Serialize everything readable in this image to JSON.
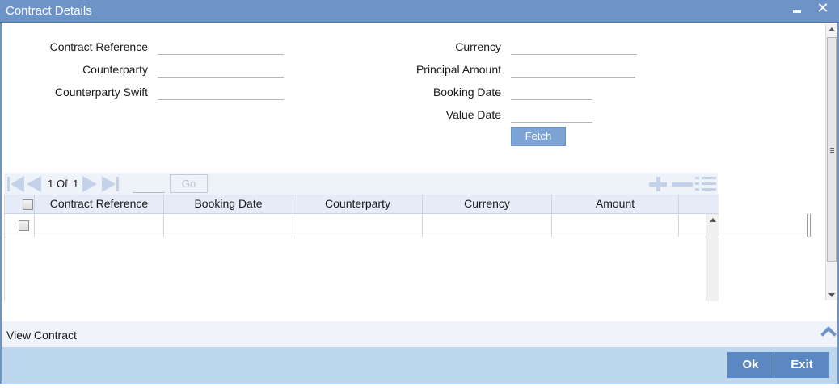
{
  "window": {
    "title": "Contract Details"
  },
  "form": {
    "left": [
      {
        "label": "Contract Reference",
        "value": ""
      },
      {
        "label": "Counterparty",
        "value": ""
      },
      {
        "label": "Counterparty Swift",
        "value": ""
      }
    ],
    "right": [
      {
        "label": "Currency",
        "value": ""
      },
      {
        "label": "Principal Amount",
        "value": ""
      },
      {
        "label": "Booking Date",
        "value": ""
      },
      {
        "label": "Value Date",
        "value": ""
      }
    ],
    "fetch_label": "Fetch"
  },
  "pager": {
    "current": "1",
    "of_label": "Of",
    "total": "1",
    "go_label": "Go",
    "page_input": ""
  },
  "grid": {
    "columns": [
      "Contract Reference",
      "Booking Date",
      "Counterparty",
      "Currency",
      "Amount"
    ],
    "rows": [
      [
        "",
        "",
        "",
        "",
        ""
      ]
    ]
  },
  "footer": {
    "section_label": "View Contract",
    "ok_label": "Ok",
    "exit_label": "Exit"
  },
  "colors": {
    "titlebar": "#6e93c7",
    "button": "#5b87c3",
    "footer": "#bdd7ee",
    "fetch": "#7ea3d6"
  }
}
